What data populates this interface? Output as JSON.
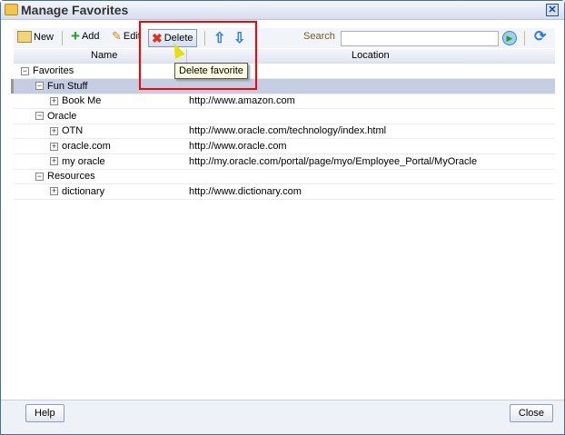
{
  "title": "Manage Favorites",
  "toolbar": {
    "new": "New",
    "add": "Add",
    "edit": "Edit",
    "delete": "Delete",
    "search_label": "Search",
    "search_value": ""
  },
  "tooltip": "Delete favorite",
  "columns": {
    "name": "Name",
    "location": "Location"
  },
  "rows": [
    {
      "name": "Favorites",
      "location": "",
      "exp": "−"
    },
    {
      "name": "Fun Stuff",
      "location": "",
      "exp": "−"
    },
    {
      "name": "Book Me",
      "location": "http://www.amazon.com",
      "exp": "+"
    },
    {
      "name": "Oracle",
      "location": "",
      "exp": "−"
    },
    {
      "name": "OTN",
      "location": "http://www.oracle.com/technology/index.html",
      "exp": "+"
    },
    {
      "name": "oracle.com",
      "location": "http://www.oracle.com",
      "exp": "+"
    },
    {
      "name": "my oracle",
      "location": "http://my.oracle.com/portal/page/myo/Employee_Portal/MyOracle",
      "exp": "+"
    },
    {
      "name": "Resources",
      "location": "",
      "exp": "−"
    },
    {
      "name": "dictionary",
      "location": "http://www.dictionary.com",
      "exp": "+"
    }
  ],
  "footer": {
    "help": "Help",
    "close": "Close"
  },
  "colors": {
    "highlight": "#ff0000",
    "selected": "#c5cde3"
  }
}
